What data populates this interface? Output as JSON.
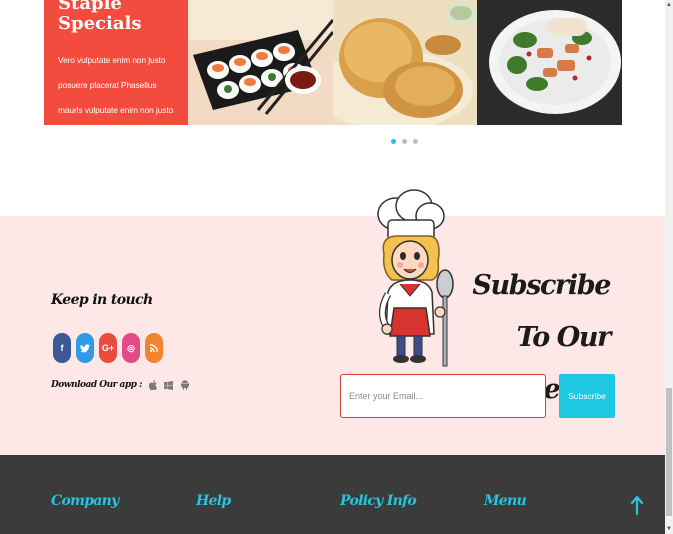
{
  "specials": {
    "title": "Staple Specials",
    "text": "Vero vulputate enim non justo posuere placerat Phasellus mauris vulputate enim non justo enim .",
    "tiles": [
      {
        "name": "sushi-tray-image"
      },
      {
        "name": "puri-bread-image"
      },
      {
        "name": "salad-plate-image"
      }
    ],
    "carousel_dots": 3,
    "active_dot": 0
  },
  "newsletter": {
    "keep_in_touch": "Keep in touch",
    "socials": [
      {
        "name": "facebook-icon",
        "glyph": "f"
      },
      {
        "name": "twitter-icon",
        "glyph": "t"
      },
      {
        "name": "google-plus-icon",
        "glyph": "G+"
      },
      {
        "name": "dribbble-icon",
        "glyph": "◎"
      },
      {
        "name": "rss-icon",
        "glyph": "◠"
      }
    ],
    "download_label": "Download Our app :",
    "apps": [
      "apple-icon",
      "windows-icon",
      "android-icon"
    ],
    "heading": "Subscribe To Our Newsletter",
    "email_placeholder": "Enter your Email...",
    "subscribe_label": "Subscribe"
  },
  "footer": {
    "company": "Company",
    "help": "Help",
    "policy": "Policy Info",
    "menu": "Menu"
  },
  "colors": {
    "special_red": "#f44b3f",
    "accent_cyan": "#25c4e0",
    "newsletter_bg": "#fde7e7",
    "footer_bg": "#3b3b3b"
  }
}
